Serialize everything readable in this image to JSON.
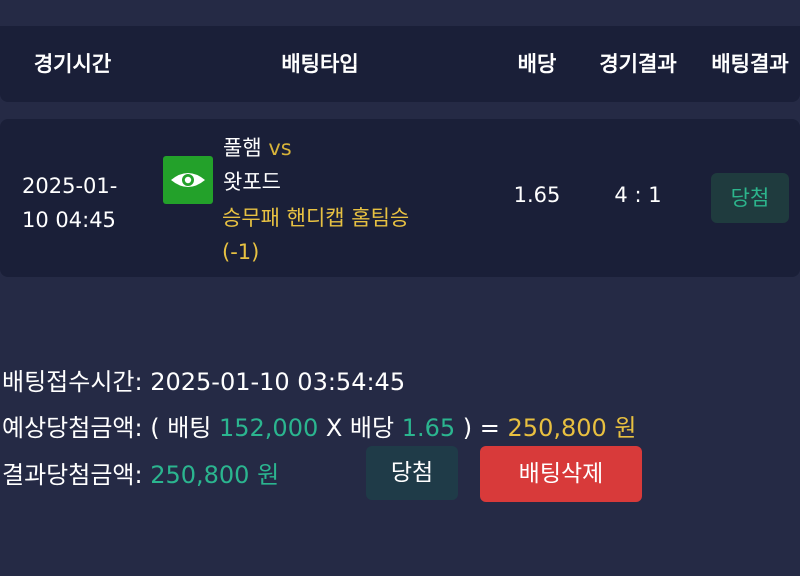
{
  "header": {
    "time": "경기시간",
    "bet_type": "배팅타입",
    "odds": "배당",
    "game_result": "경기결과",
    "bet_result": "배팅결과"
  },
  "bet_row": {
    "datetime_line1": "2025-01-",
    "datetime_line2": "10 04:45",
    "team_home": "풀햄",
    "vs": "vs",
    "team_away": "왓포드",
    "bet_type_line1": "승무패 핸디캡 홈팀승",
    "bet_type_line2": "(-1)",
    "odds": "1.65",
    "score": "4 : 1",
    "result_badge": "당첨",
    "icon": "eye-icon"
  },
  "summary": {
    "receipt_label": "배팅접수시간: ",
    "receipt_time": "2025-01-10 03:54:45",
    "expected_label": "예상당첨금액: ",
    "open_paren": "( 배팅 ",
    "stake": "152,000",
    "times_odds": " X 배당 ",
    "odds": "1.65",
    "close_eq": " ) = ",
    "expected_amount": "250,800 원",
    "result_label": "결과당첨금액: ",
    "result_amount": "250,800 원"
  },
  "buttons": {
    "win": "당첨",
    "delete": "배팅삭제"
  },
  "colors": {
    "background": "#252a45",
    "card": "#1a1f38",
    "teal": "#2bb58f",
    "gold": "#e8c040",
    "delete_red": "#d83a3a",
    "icon_green": "#23a12a"
  }
}
